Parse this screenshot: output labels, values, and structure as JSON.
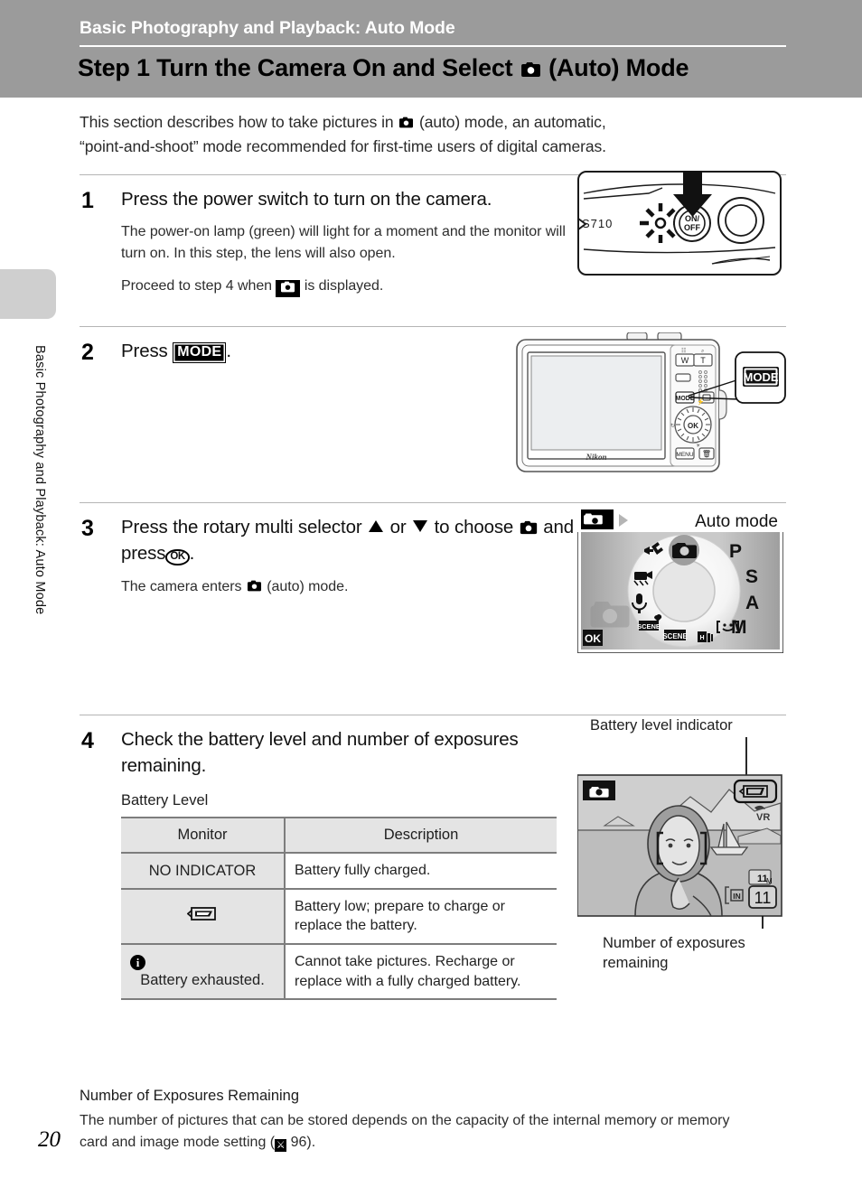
{
  "header": {
    "chapter": "Basic Photography and Playback: Auto Mode",
    "title_before": "Step 1 Turn the Camera On and Select",
    "title_after": "(Auto) Mode",
    "band_color": "#9b9b9b"
  },
  "sidebar": {
    "vertical_label": "Basic Photography and Playback: Auto Mode",
    "tab_color": "#cfcfcf"
  },
  "page_number": "20",
  "intro": {
    "line1_a": "This section describes how to take pictures in",
    "line1_b": "(auto) mode, an automatic,",
    "line2": "“point-and-shoot” mode recommended for first-time users of digital cameras."
  },
  "steps": [
    {
      "number": "1",
      "heading": "Press the power switch to turn on the camera.",
      "body1": "The power-on lamp (green) will light for a moment and the monitor will turn on. In this step, the lens will also open.",
      "body2_a": "Proceed to step 4 when",
      "body2_b": "is displayed.",
      "figure": {
        "name": "camera-top-view",
        "model_label": "S710",
        "power_button_label_top": "ON/",
        "power_button_label_bottom": "OFF"
      }
    },
    {
      "number": "2",
      "heading_a": "Press",
      "heading_button": "MODE",
      "heading_b": ".",
      "figure": {
        "name": "camera-back-view",
        "brand": "Nikon",
        "zoom_wide": "W",
        "zoom_tele": "T",
        "ok_label": "OK",
        "menu_label": "MENU",
        "callout_label": "MODE"
      }
    },
    {
      "number": "3",
      "heading_a": "Press the rotary multi selector",
      "heading_or": "or",
      "heading_b": "to choose",
      "heading_c": "and press",
      "heading_d": ".",
      "body1_a": "The camera enters",
      "body1_b": "(auto) mode.",
      "figure": {
        "name": "mode-dial-screen",
        "screen_title": "Auto mode",
        "ok_label": "OK",
        "dial_letters": [
          "P",
          "S",
          "A",
          "M"
        ],
        "dial_icons": [
          "setup-wrench-icon",
          "movie-icon",
          "voice-recording-icon",
          "scene-auto-selector-icon",
          "scene-icon",
          "high-sensitivity-icon",
          "smile-mode-icon",
          "auto-camera-icon"
        ]
      }
    },
    {
      "number": "4",
      "heading": "Check the battery level and number of exposures remaining.",
      "section_title": "Battery Level",
      "table": {
        "headers": [
          "Monitor",
          "Description"
        ],
        "rows": [
          {
            "monitor_text": "NO INDICATOR",
            "monitor_icon": "",
            "description": "Battery fully charged."
          },
          {
            "monitor_text": "",
            "monitor_icon": "battery-low-icon",
            "description": "Battery low; prepare to charge or replace the battery."
          },
          {
            "monitor_text": "Battery exhausted.",
            "monitor_icon": "info-circle-icon",
            "description": "Cannot take pictures. Recharge or replace with a fully charged battery."
          }
        ]
      },
      "figure": {
        "name": "monitor-display",
        "caption_top": "Battery level indicator",
        "caption_bottom": "Number of exposures remaining",
        "exposures_value": "11",
        "image_mode_label": "M",
        "internal_memory_label": "IN",
        "vr_label": "VR"
      }
    }
  ],
  "tail": {
    "title": "Number of Exposures Remaining",
    "body_a": "The number of pictures that can be stored depends on the capacity of the internal memory or memory card and image mode setting (",
    "ref_page": "96",
    "body_b": ")."
  }
}
